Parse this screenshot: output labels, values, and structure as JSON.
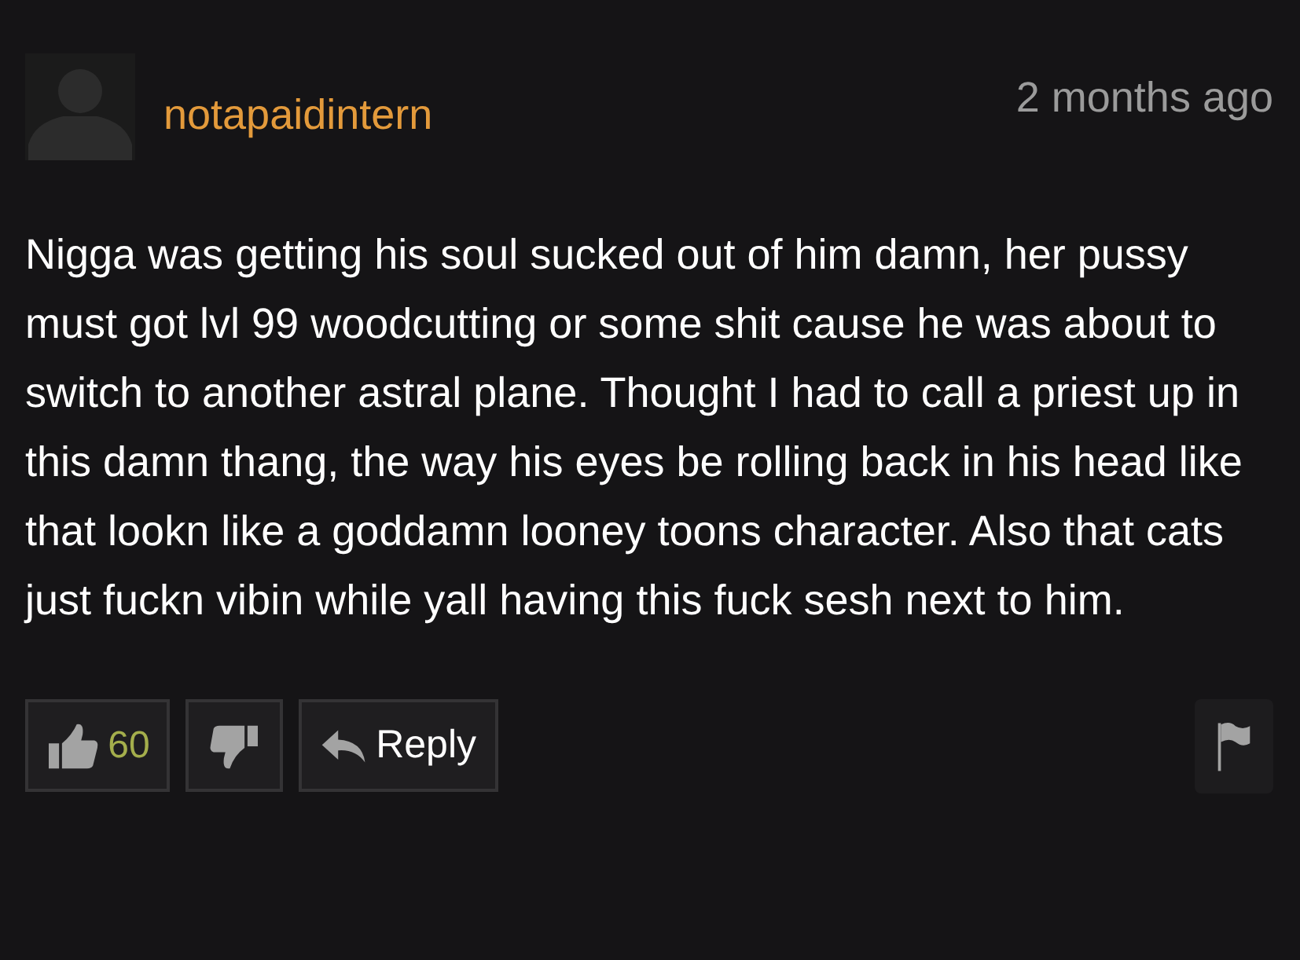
{
  "comment": {
    "username": "notapaidintern",
    "time": "2 months ago",
    "paragraphs": [
      "Nigga was getting his soul sucked out of him damn, her pussy must got lvl 99 woodcutting or some shit cause he was about to",
      "switch to another astral plane. Thought I had to call a priest up in this damn thang, the way his eyes be rolling back in his head like that lookn like a goddamn looney toons character. Also that cats just fuckn vibin while yall having this fuck sesh next to him."
    ],
    "likes": "60",
    "reply": "Reply"
  }
}
